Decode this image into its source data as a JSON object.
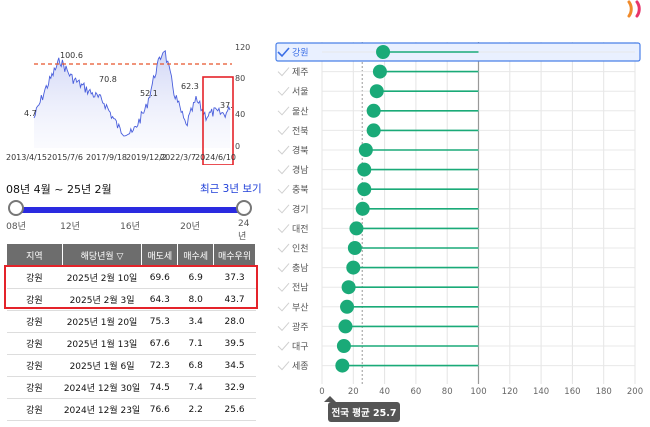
{
  "deco_glyph": "״",
  "line_chart": {
    "x_labels": [
      "2013/4/15",
      "2015/7/6",
      "2017/9/18",
      "2019/12/2",
      "2022/3/7",
      "2024/6/10"
    ],
    "y_labels": [
      "120",
      "80",
      "40",
      "0"
    ],
    "annotations": [
      "100.6",
      "70.8",
      "52.1",
      "62.3",
      "37.",
      "4.7"
    ],
    "dashed_line_color": "#e8542a",
    "series_color": "#4a5fdc"
  },
  "range": {
    "title": "08년 4월 ~ 25년 2월",
    "recent_link": "최근 3년 보기"
  },
  "slider": {
    "ticks": [
      "08년",
      "12년",
      "16년",
      "20년",
      "24년"
    ],
    "low": 0,
    "high": 1
  },
  "table": {
    "headers": [
      "지역",
      "해당년월 ▽",
      "매도세",
      "매수세",
      "매수우위"
    ],
    "rows": [
      [
        "강원",
        "2025년 2월 10일",
        "69.6",
        "6.9",
        "37.3"
      ],
      [
        "강원",
        "2025년 2월 3일",
        "64.3",
        "8.0",
        "43.7"
      ],
      [
        "강원",
        "2025년 1월 20일",
        "75.3",
        "3.4",
        "28.0"
      ],
      [
        "강원",
        "2025년 1월 13일",
        "67.6",
        "7.1",
        "39.5"
      ],
      [
        "강원",
        "2025년 1월 6일",
        "72.3",
        "6.8",
        "34.5"
      ],
      [
        "강원",
        "2024년 12월 30일",
        "74.5",
        "7.4",
        "32.9"
      ],
      [
        "강원",
        "2024년 12월 23일",
        "76.6",
        "2.2",
        "25.6"
      ]
    ]
  },
  "chart_data": {
    "type": "lollipop",
    "categories": [
      "강원",
      "제주",
      "서울",
      "울산",
      "전북",
      "경북",
      "경남",
      "충북",
      "경기",
      "대전",
      "인천",
      "충남",
      "전남",
      "부산",
      "광주",
      "대구",
      "세종"
    ],
    "values": [
      39,
      37,
      35,
      33,
      33,
      28,
      27,
      27,
      26,
      22,
      21,
      20,
      17,
      16,
      15,
      14,
      13
    ],
    "selected": "강원",
    "xlim": [
      0,
      200
    ],
    "xticks": [
      "0",
      "20",
      "40",
      "60",
      "80",
      "100",
      "120",
      "140",
      "160",
      "180",
      "200"
    ],
    "reference_value": 100,
    "national_average": 25.7,
    "average_label": "전국 평균 25.7",
    "point_color": "#1aaa78"
  }
}
